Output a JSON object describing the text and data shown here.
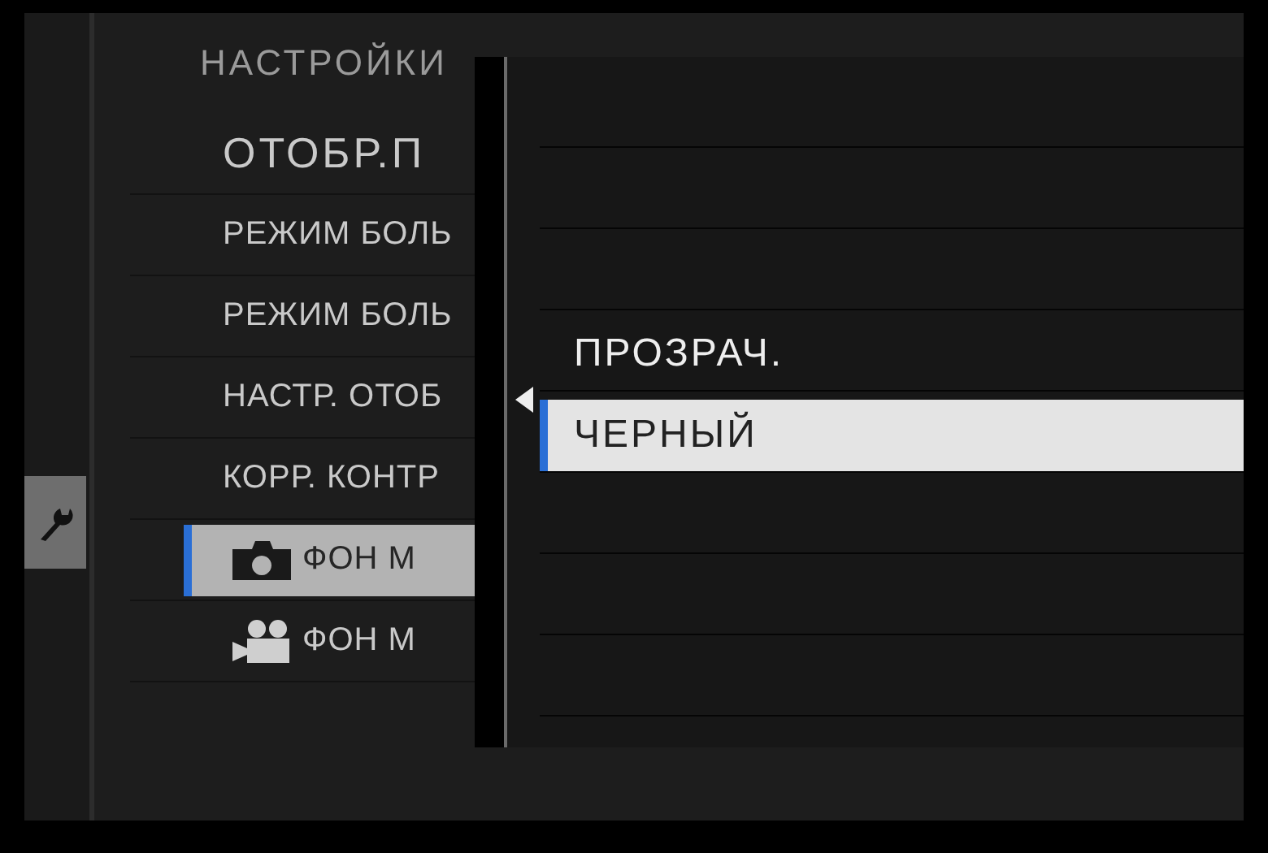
{
  "side_tabs": [
    {
      "kind": "wrench",
      "selected": true
    }
  ],
  "menu": {
    "title": "НАСТРОЙКИ",
    "items": [
      {
        "kind": "heading",
        "label": "ОТОБР.П",
        "selected": false
      },
      {
        "kind": "text",
        "label": "РЕЖИМ БОЛЬ",
        "selected": false
      },
      {
        "kind": "text",
        "label": "РЕЖИМ БОЛЬ",
        "selected": false
      },
      {
        "kind": "text",
        "label": "НАСТР. ОТОБ",
        "selected": false
      },
      {
        "kind": "text",
        "label": "КОРР. КОНТР",
        "selected": false
      },
      {
        "kind": "photo",
        "label": "ФОН М",
        "selected": true
      },
      {
        "kind": "video",
        "label": "ФОН М",
        "selected": false
      }
    ]
  },
  "popup": {
    "options": [
      {
        "label": "ПРОЗРАЧ.",
        "selected": false
      },
      {
        "label": "ЧЕРНЫЙ",
        "selected": true
      }
    ]
  }
}
